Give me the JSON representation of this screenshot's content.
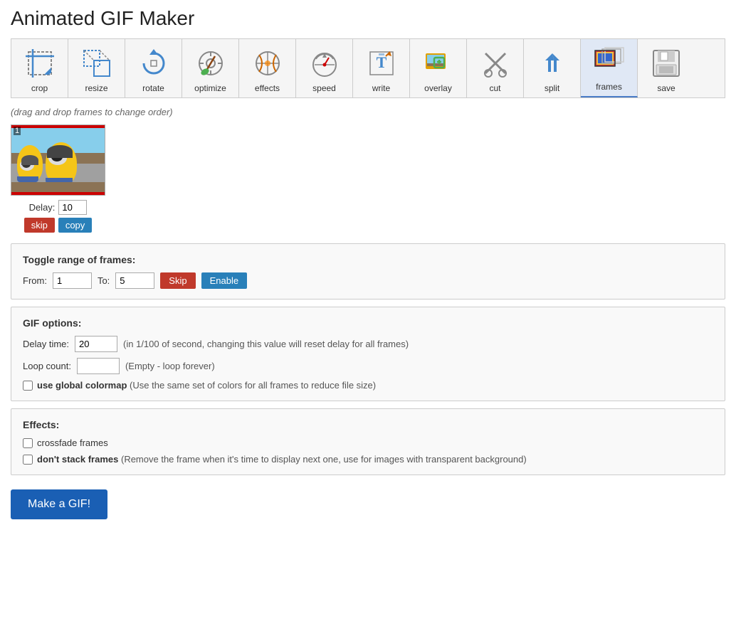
{
  "page": {
    "title": "Animated GIF Maker"
  },
  "toolbar": {
    "items": [
      {
        "id": "crop",
        "label": "crop",
        "icon": "crop-icon",
        "active": false
      },
      {
        "id": "resize",
        "label": "resize",
        "icon": "resize-icon",
        "active": false
      },
      {
        "id": "rotate",
        "label": "rotate",
        "icon": "rotate-icon",
        "active": false
      },
      {
        "id": "optimize",
        "label": "optimize",
        "icon": "optimize-icon",
        "active": false
      },
      {
        "id": "effects",
        "label": "effects",
        "icon": "effects-icon",
        "active": false
      },
      {
        "id": "speed",
        "label": "speed",
        "icon": "speed-icon",
        "active": false
      },
      {
        "id": "write",
        "label": "write",
        "icon": "write-icon",
        "active": false
      },
      {
        "id": "overlay",
        "label": "overlay",
        "icon": "overlay-icon",
        "active": false
      },
      {
        "id": "cut",
        "label": "cut",
        "icon": "cut-icon",
        "active": false
      },
      {
        "id": "split",
        "label": "split",
        "icon": "split-icon",
        "active": false
      },
      {
        "id": "frames",
        "label": "frames",
        "icon": "frames-icon",
        "active": true
      },
      {
        "id": "save",
        "label": "save",
        "icon": "save-icon",
        "active": false
      }
    ]
  },
  "drag_hint": "(drag and drop frames to change order)",
  "frame": {
    "number": "1",
    "delay_label": "Delay:",
    "delay_value": "10",
    "skip_label": "skip",
    "copy_label": "copy"
  },
  "toggle_range": {
    "title": "Toggle range of frames:",
    "from_label": "From:",
    "from_value": "1",
    "to_label": "To:",
    "to_value": "5",
    "skip_label": "Skip",
    "enable_label": "Enable"
  },
  "gif_options": {
    "title": "GIF options:",
    "delay_label": "Delay time:",
    "delay_value": "20",
    "delay_hint": "in 1/100 of second, changing this value will reset delay for all frames)",
    "delay_hint_prefix": "(in 1/100 of second, changing this value will reset delay for all frames)",
    "loop_label": "Loop count:",
    "loop_value": "",
    "loop_hint": "(Empty - loop forever)",
    "colormap_label": "use global colormap",
    "colormap_hint": "(Use the same set of colors for all frames to reduce file size)"
  },
  "effects": {
    "title": "Effects:",
    "crossfade_label": "crossfade frames",
    "no_stack_label": "don't stack frames",
    "no_stack_hint": "(Remove the frame when it's time to display next one, use for images with transparent background)"
  },
  "make_gif_button": "Make a GIF!"
}
